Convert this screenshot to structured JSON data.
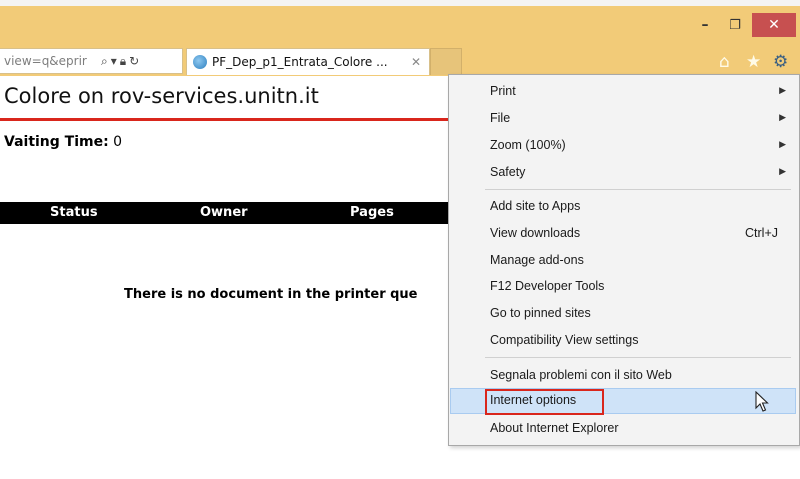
{
  "browser": {
    "address_text": "view=q&eprir",
    "tab_title": "PF_Dep_p1_Entrata_Colore ...",
    "tab_close": "✕",
    "window_controls": {
      "minimize": "–",
      "maximize": "❐",
      "close": "✕"
    },
    "toolbar_icons": [
      "home-icon",
      "star-icon",
      "gear-icon"
    ]
  },
  "page": {
    "title": "Colore on rov-services.unitn.it",
    "waiting_label": "Vaiting Time:",
    "waiting_value": "0",
    "table_headers": [
      "Status",
      "Owner",
      "Pages"
    ],
    "empty_message": "There is no document in the printer que"
  },
  "menu": {
    "items": [
      {
        "label": "Print",
        "submenu": true
      },
      {
        "label": "File",
        "submenu": true
      },
      {
        "label": "Zoom (100%)",
        "submenu": true
      },
      {
        "label": "Safety",
        "submenu": true
      },
      {
        "label": "Add site to Apps"
      },
      {
        "label": "View downloads",
        "shortcut": "Ctrl+J"
      },
      {
        "label": "Manage add-ons"
      },
      {
        "label": "F12 Developer Tools"
      },
      {
        "label": "Go to pinned sites"
      },
      {
        "label": "Compatibility View settings"
      },
      {
        "label": "Segnala problemi con il sito Web"
      },
      {
        "label": "Internet options",
        "highlighted": true
      },
      {
        "label": "About Internet Explorer"
      }
    ]
  },
  "colors": {
    "titlebar": "#f2cb78",
    "close_button": "#c75050",
    "accent_red": "#d9261c",
    "menu_highlight": "#cfe3f8"
  }
}
